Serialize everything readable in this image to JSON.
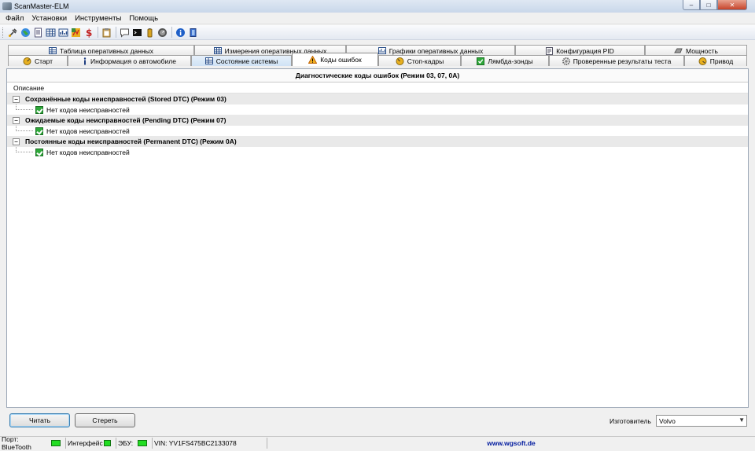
{
  "window": {
    "title": "ScanMaster-ELM",
    "minimize": "–",
    "maximize": "□",
    "close": "✕"
  },
  "menu": [
    "Файл",
    "Установки",
    "Инструменты",
    "Помощь"
  ],
  "toolbar": {
    "icons": [
      "connect-icon",
      "globe-icon",
      "document-icon",
      "table-icon",
      "chart-icon",
      "dashboard-icon",
      "dollar-icon",
      "clipboard-icon",
      "chat-icon",
      "terminal-icon",
      "battery-icon",
      "gauge-icon",
      "info-icon",
      "door-icon"
    ]
  },
  "tabs_row1": [
    {
      "label": "Таблица оперативных данных",
      "icon": "table-icon"
    },
    {
      "label": "Измерения оперативных данных",
      "icon": "measure-icon"
    },
    {
      "label": "Графики оперативных данных",
      "icon": "chart-icon"
    },
    {
      "label": "Конфигурация PID",
      "icon": "config-icon"
    },
    {
      "label": "Мощность",
      "icon": "power-icon"
    }
  ],
  "tabs_row2": [
    {
      "label": "Старт",
      "icon": "start-icon"
    },
    {
      "label": "Информация о автомобиле",
      "icon": "info-icon"
    },
    {
      "label": "Состояние системы",
      "icon": "status-icon"
    },
    {
      "label": "Коды ошибок",
      "icon": "warning-icon"
    },
    {
      "label": "Стоп-кадры",
      "icon": "freeze-frame-icon"
    },
    {
      "label": "Лямбда-зонды",
      "icon": "lambda-icon"
    },
    {
      "label": "Проверенные результаты теста",
      "icon": "test-icon"
    },
    {
      "label": "Привод",
      "icon": "drive-icon"
    }
  ],
  "panel": {
    "header": "Диагностические коды ошибок (Режим 03, 07, 0А)",
    "column": "Описание",
    "groups": [
      {
        "title": "Сохранённые коды неисправностей (Stored DTC) (Режим 03)",
        "item": "Нет кодов неисправностей"
      },
      {
        "title": "Ожидаемые коды неисправностей (Pending DTC) (Режим 07)",
        "item": "Нет кодов неисправностей"
      },
      {
        "title": "Постоянные коды неисправностей (Permanent DTC) (Режим 0А)",
        "item": "Нет кодов неисправностей"
      }
    ],
    "collapse_glyph": "−"
  },
  "buttons": {
    "read": "Читать",
    "clear": "Стереть"
  },
  "manufacturer": {
    "label": "Изготовитель",
    "value": "Volvo"
  },
  "status": {
    "port": "Порт: BlueTooth",
    "interface": "Интерфейс",
    "ecu": "ЭБУ:",
    "vin": "VIN: YV1FS475BC2133078",
    "link": "www.wgsoft.de",
    "led_color": "#22dd22"
  }
}
